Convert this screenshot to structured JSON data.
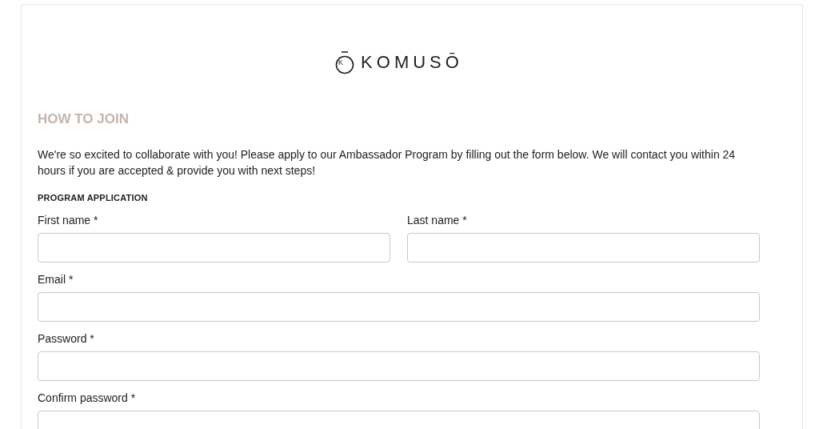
{
  "logo": {
    "mark": "K",
    "name": "KOMUSŌ"
  },
  "heading": "HOW TO JOIN",
  "intro": "We're so excited to collaborate with you! Please apply to our Ambassador Program by filling out the form below. We will contact you within 24 hours if you are accepted & provide you with next steps!",
  "section_title": "PROGRAM APPLICATION",
  "rows": [
    [
      {
        "label": "First name *"
      },
      {
        "label": "Last name *"
      }
    ],
    [
      {
        "label": "Email *"
      }
    ],
    [
      {
        "label": "Password *"
      }
    ],
    [
      {
        "label": "Confirm password *"
      }
    ]
  ]
}
